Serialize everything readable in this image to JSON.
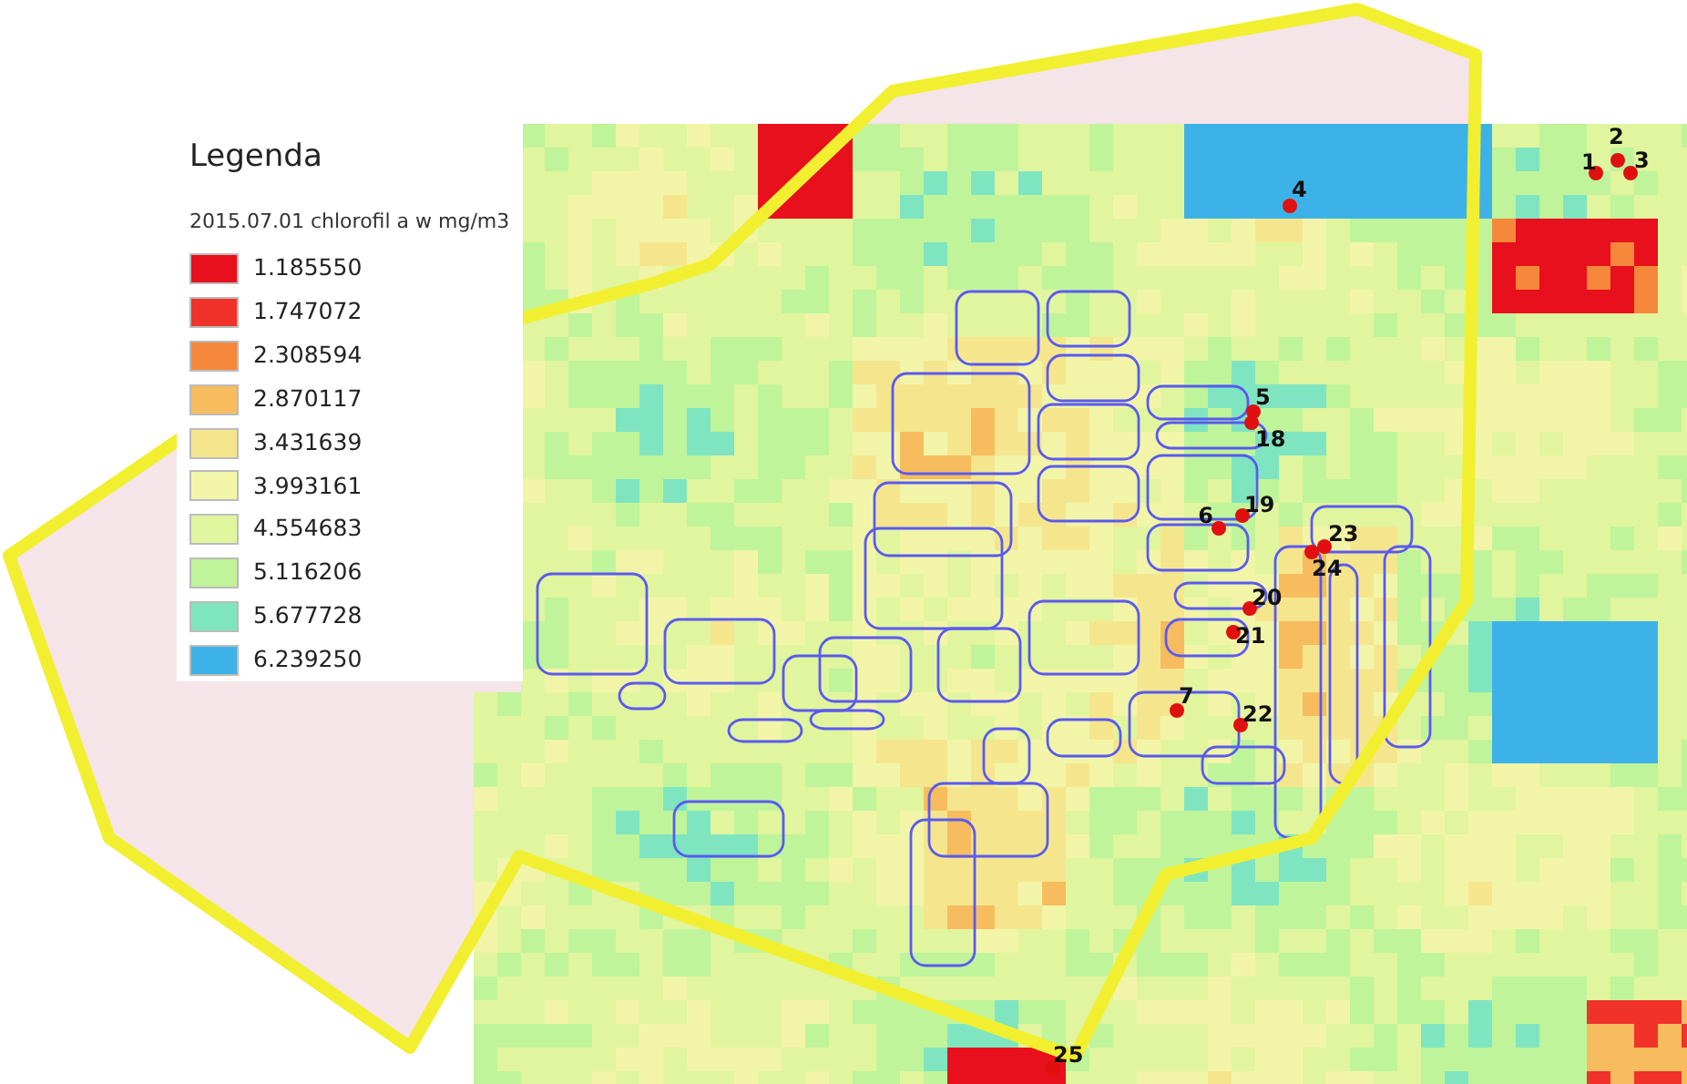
{
  "legend": {
    "title": "Legenda",
    "subtitle": "2015.07.01 chlorofil a w mg/m3",
    "items": [
      {
        "label": "1.185550",
        "color": "#e8101c"
      },
      {
        "label": "1.747072",
        "color": "#f0322a"
      },
      {
        "label": "2.308594",
        "color": "#f5883a"
      },
      {
        "label": "2.870117",
        "color": "#f7bc5e"
      },
      {
        "label": "3.431639",
        "color": "#f5e68e"
      },
      {
        "label": "3.993161",
        "color": "#f2f5a8"
      },
      {
        "label": "4.554683",
        "color": "#e0f59e"
      },
      {
        "label": "5.116206",
        "color": "#bff49a"
      },
      {
        "label": "5.677728",
        "color": "#7fe5c0"
      },
      {
        "label": "6.239250",
        "color": "#3db2e8"
      }
    ]
  },
  "points": [
    {
      "label": "1"
    },
    {
      "label": "2"
    },
    {
      "label": "3"
    },
    {
      "label": "4"
    },
    {
      "label": "5"
    },
    {
      "label": "18"
    },
    {
      "label": "6"
    },
    {
      "label": "19"
    },
    {
      "label": "23"
    },
    {
      "label": "24"
    },
    {
      "label": "20"
    },
    {
      "label": "21"
    },
    {
      "label": "7"
    },
    {
      "label": "22"
    },
    {
      "label": "25"
    }
  ]
}
